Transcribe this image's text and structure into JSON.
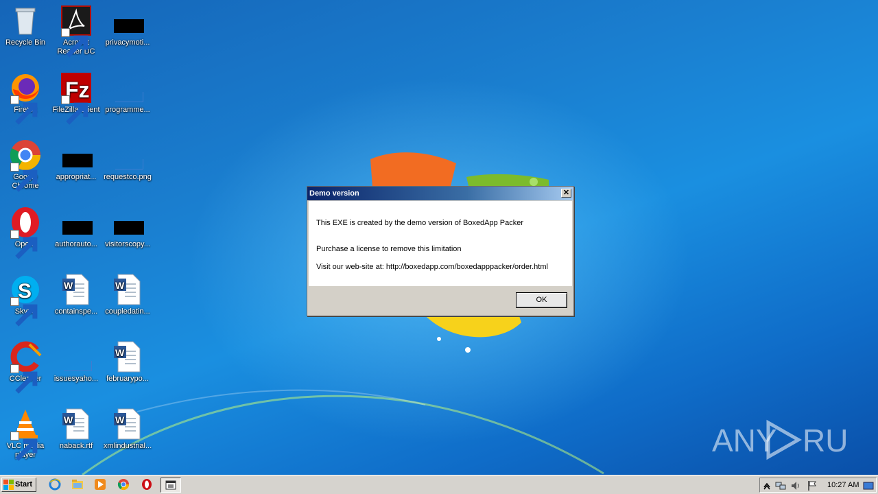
{
  "desktop": {
    "icons": [
      {
        "label": "Recycle Bin",
        "icon": "recycle-bin-icon"
      },
      {
        "label": "Acrobat Reader DC",
        "icon": "acrobat-reader-icon"
      },
      {
        "label": "privacymoti...",
        "icon": "redacted-file-icon"
      },
      {
        "label": "Firefox",
        "icon": "firefox-icon"
      },
      {
        "label": "FileZilla Client",
        "icon": "filezilla-icon"
      },
      {
        "label": "programme...",
        "icon": "blank-file-icon"
      },
      {
        "label": "Google Chrome",
        "icon": "chrome-icon"
      },
      {
        "label": "appropriat...",
        "icon": "redacted-file-icon"
      },
      {
        "label": "requestco.png",
        "icon": "blank-file-icon"
      },
      {
        "label": "Opera",
        "icon": "opera-icon"
      },
      {
        "label": "authorauto...",
        "icon": "redacted-file-icon"
      },
      {
        "label": "visitorscopy...",
        "icon": "redacted-file-icon"
      },
      {
        "label": "Skype",
        "icon": "skype-icon"
      },
      {
        "label": "containspe...",
        "icon": "word-doc-icon"
      },
      {
        "label": "coupledatin...",
        "icon": "word-doc-icon"
      },
      {
        "label": "CCleaner",
        "icon": "ccleaner-icon"
      },
      {
        "label": "issuesyaho...",
        "icon": "blank-file-icon"
      },
      {
        "label": "februarypo...",
        "icon": "word-doc-icon"
      },
      {
        "label": "VLC media player",
        "icon": "vlc-icon"
      },
      {
        "label": "naback.rtf",
        "icon": "word-doc-icon"
      },
      {
        "label": "xmlindustrial...",
        "icon": "word-doc-icon"
      }
    ]
  },
  "dialog": {
    "title": "Demo version",
    "close_label": "✕",
    "line1": "This EXE is created by the demo version of BoxedApp Packer",
    "line2": "Purchase a license to remove this limitation",
    "line3": "Visit our web-site at: http://boxedapp.com/boxedapppacker/order.html",
    "ok_label": "OK"
  },
  "taskbar": {
    "start_label": "Start",
    "quick_launch": [
      "internet-explorer-icon",
      "folder-icon",
      "media-player-icon",
      "chrome-icon",
      "opera-icon"
    ],
    "active_task_icon": "app-window-icon",
    "tray": [
      "show-hidden-icons-icon",
      "network-icon",
      "volume-icon",
      "action-center-flag-icon",
      "show-desktop-icon"
    ],
    "clock": "10:27 AM"
  },
  "watermark": {
    "text": "ANY RUN"
  }
}
